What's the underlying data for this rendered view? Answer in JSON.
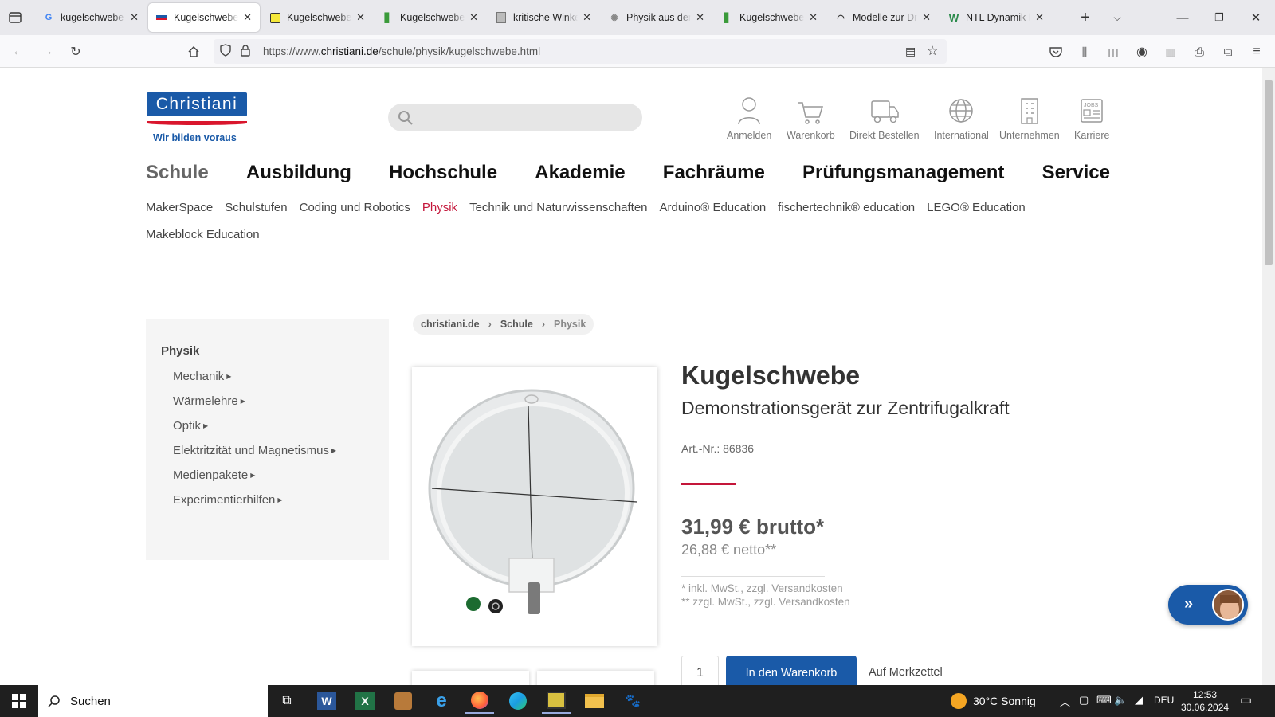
{
  "browser": {
    "tabs": [
      {
        "title": "kugelschwebe physik",
        "favicon": "google-icon",
        "active": false
      },
      {
        "title": "Kugelschwebe online",
        "favicon": "christiani-icon",
        "active": true
      },
      {
        "title": "Kugelschwebe/Zentrifugalkraft",
        "favicon": "note-icon",
        "active": false
      },
      {
        "title": "Kugelschwebe / Leifi",
        "favicon": "leifi-icon",
        "active": false
      },
      {
        "title": "kritische Winkelgeschwindigkeit",
        "favicon": "document-icon",
        "active": false
      },
      {
        "title": "Physik aus dem Alltag",
        "favicon": "globe-icon",
        "active": false
      },
      {
        "title": "Kugelschwebe | Leifi",
        "favicon": "leifi-icon",
        "active": false
      },
      {
        "title": "Modelle zur Drehbewegung",
        "favicon": "headset-icon",
        "active": false
      },
      {
        "title": "NTL Dynamik bei Kreisbewegung",
        "favicon": "w-icon",
        "active": false
      }
    ],
    "url": {
      "prefix": "https://www.",
      "domain": "christiani.de",
      "path": "/schule/physik/kugelschwebe.html"
    }
  },
  "header": {
    "logo_text": "Christiani",
    "logo_claim": "Wir bilden voraus",
    "icons": [
      {
        "label": "Anmelden",
        "icon": "user-icon"
      },
      {
        "label": "Warenkorb",
        "icon": "cart-icon"
      },
      {
        "label": "Direkt Bestellen",
        "icon": "truck-icon"
      },
      {
        "label": "International",
        "icon": "globe-icon"
      },
      {
        "label": "Unternehmen",
        "icon": "building-icon"
      },
      {
        "label": "Karriere",
        "icon": "jobs-icon"
      }
    ]
  },
  "mainnav": [
    "Schule",
    "Ausbildung",
    "Hochschule",
    "Akademie",
    "Fachräume",
    "Prüfungsmanagement",
    "Service"
  ],
  "subnav": [
    "MakerSpace",
    "Schulstufen",
    "Coding und Robotics",
    "Physik",
    "Technik und Naturwissenschaften",
    "Arduino® Education",
    "fischertechnik® education",
    "LEGO® Education",
    "Makeblock Education"
  ],
  "sidebar": {
    "heading": "Physik",
    "items": [
      "Mechanik",
      "Wärmelehre",
      "Optik",
      "Elektritzität und Magnetismus",
      "Medienpakete",
      "Experimentierhilfen"
    ]
  },
  "breadcrumb": [
    "christiani.de",
    "Schule",
    "Physik"
  ],
  "product": {
    "title": "Kugelschwebe",
    "subtitle": "Demonstrationsgerät zur Zentrifugalkraft",
    "art_nr": "Art.-Nr.: 86836",
    "price_gross": "31,99 € brutto*",
    "price_net": "26,88 € netto**",
    "note_gross": "* inkl. MwSt., zzgl. Versandkosten",
    "note_net": "** zzgl. MwSt., zzgl. Versandkosten",
    "quantity": "1",
    "cart_button": "In den Warenkorb",
    "wishlist": "Auf Merkzettel"
  },
  "taskbar": {
    "search": "Suchen",
    "weather": "30°C  Sonnig",
    "lang": "DEU",
    "time": "12:53",
    "date": "30.06.2024"
  },
  "colors": {
    "brand_blue": "#1a5aa8",
    "brand_red": "#c4163a"
  }
}
